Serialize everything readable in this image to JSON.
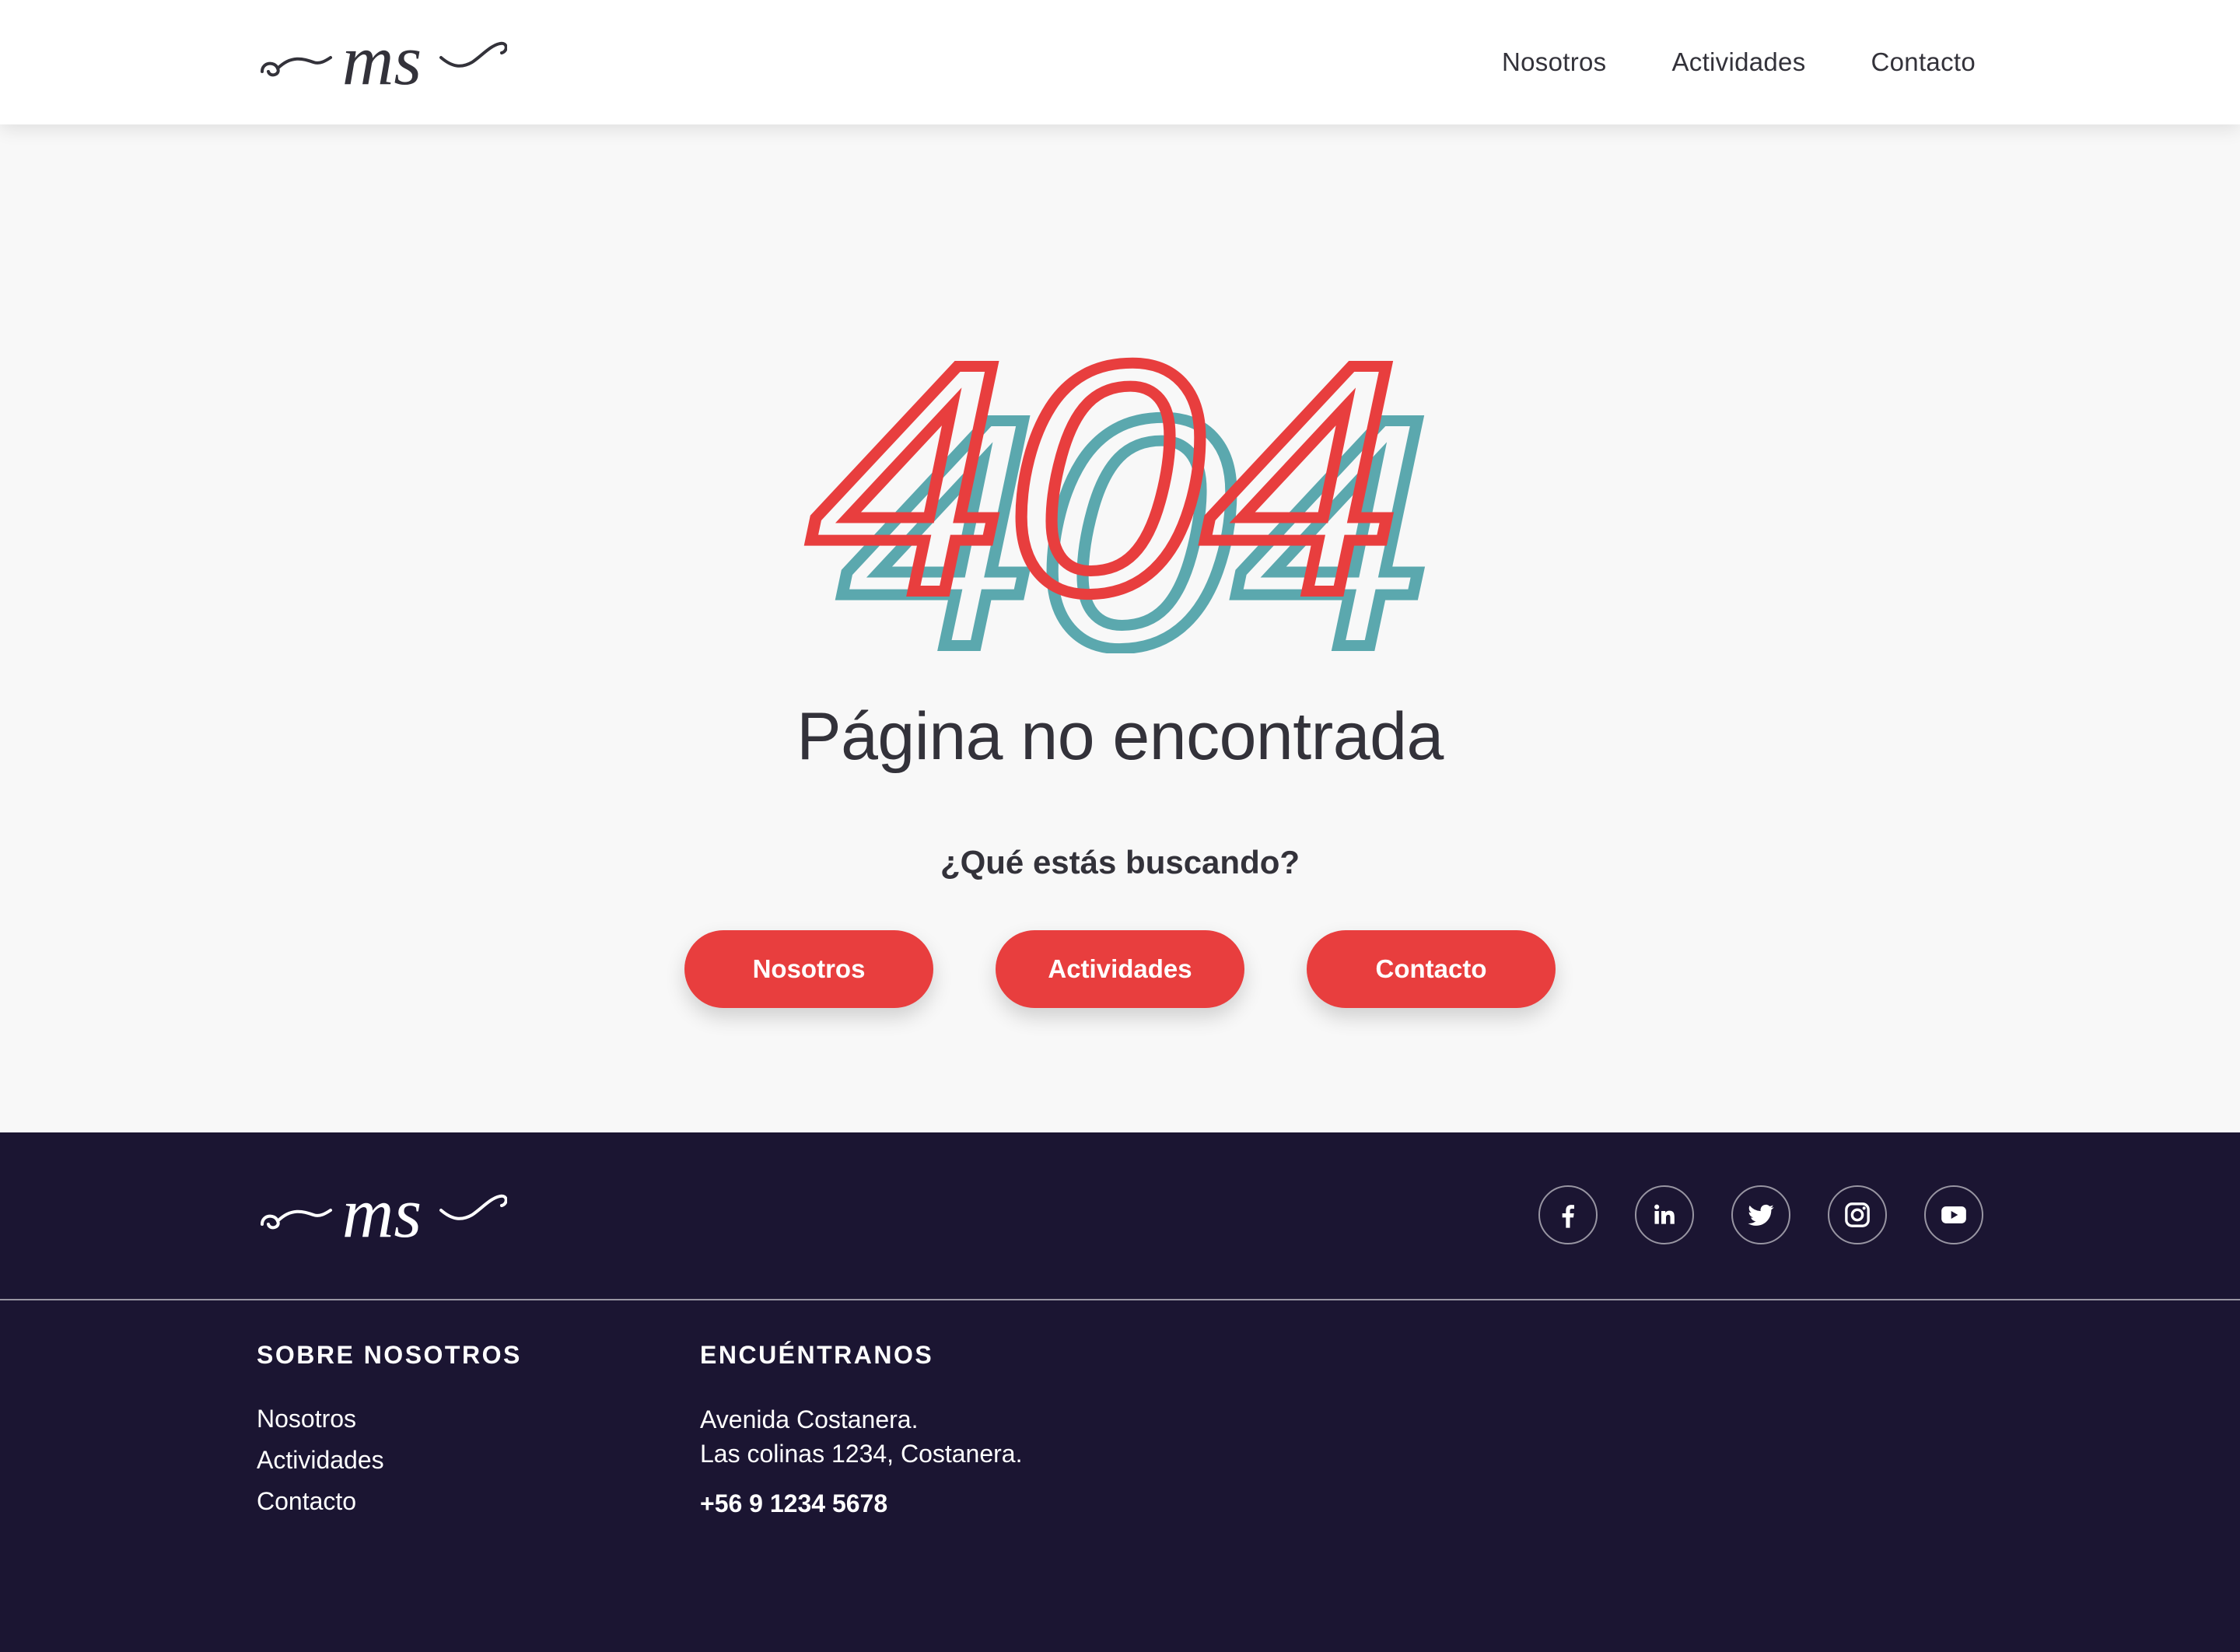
{
  "header": {
    "logo_text": "ms",
    "nav": [
      "Nosotros",
      "Actividades",
      "Contacto"
    ]
  },
  "main": {
    "error_code": "404",
    "title": "Página no encontrada",
    "question": "¿Qué estás buscando?",
    "buttons": [
      "Nosotros",
      "Actividades",
      "Contacto"
    ]
  },
  "footer": {
    "logo_text": "ms",
    "social_icons": [
      "facebook-icon",
      "linkedin-icon",
      "twitter-icon",
      "instagram-icon",
      "youtube-icon"
    ],
    "about": {
      "heading": "SOBRE NOSOTROS",
      "links": [
        "Nosotros",
        "Actividades",
        "Contacto"
      ]
    },
    "find": {
      "heading": "ENCUÉNTRANOS",
      "address_line1": "Avenida Costanera.",
      "address_line2": "Las colinas 1234, Costanera.",
      "phone": "+56 9 1234 5678"
    }
  },
  "colors": {
    "accent_red": "#e83e3e",
    "accent_teal": "#5ba8ae",
    "footer_bg": "#1b1532",
    "text_dark": "#33323a",
    "page_bg": "#f8f8f8"
  }
}
